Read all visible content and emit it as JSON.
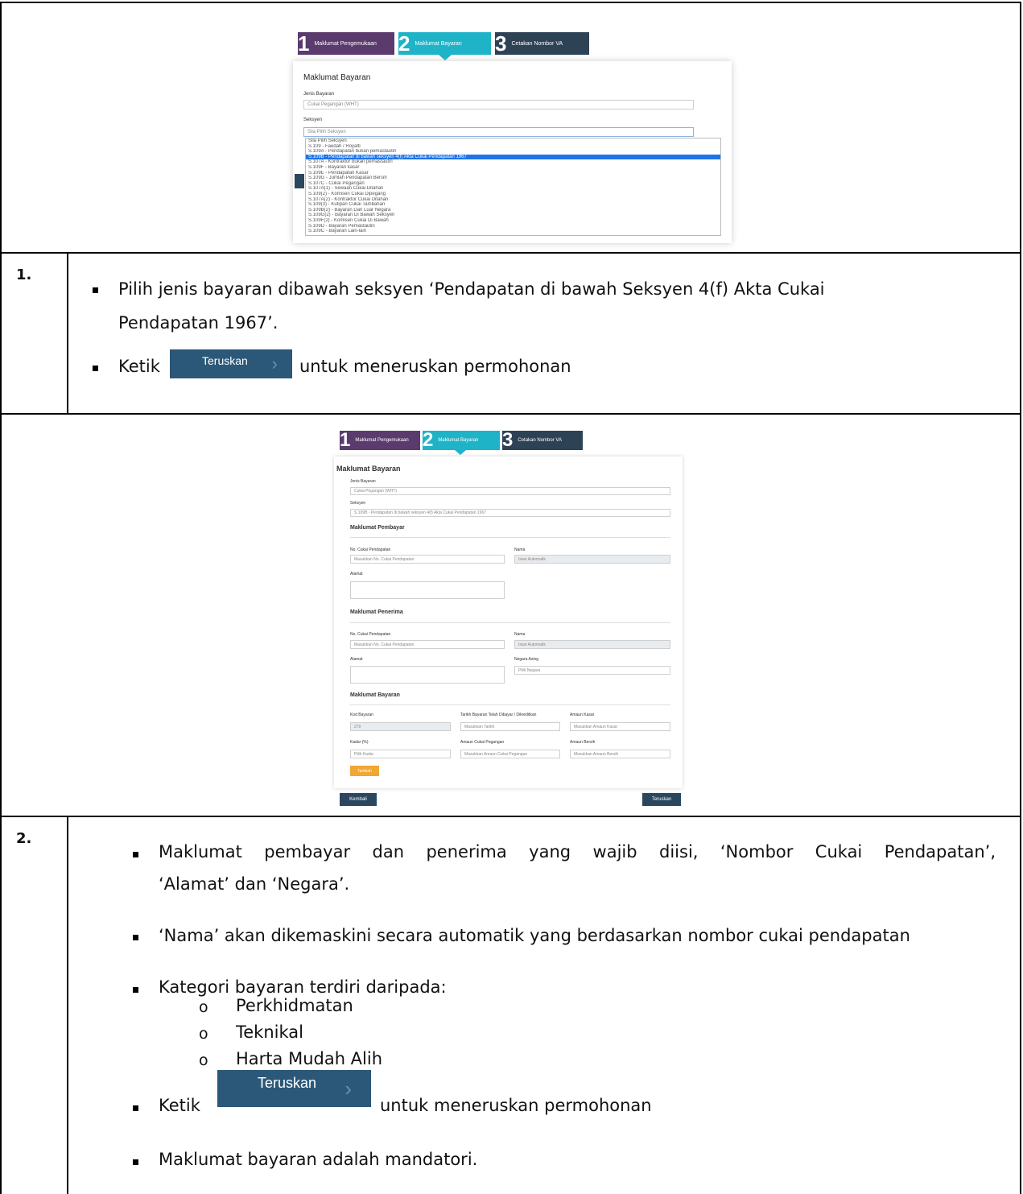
{
  "step_screenshot_1": {
    "steps": [
      {
        "num": "1",
        "label": "Maklumat Pengemukaan"
      },
      {
        "num": "2",
        "label": "Maklumat Bayaran"
      },
      {
        "num": "3",
        "label": "Cetakan Nombor VA"
      }
    ],
    "form_title": "Maklumat Bayaran",
    "jenis_label": "Jenis Bayaran",
    "jenis_value": "Cukai Pegangan (WHT)",
    "seksyen_label": "Seksyen",
    "seksyen_value": "Sila Pilih Seksyen",
    "dropdown_options": [
      "Sila Pilih Seksyen",
      "S.109 - Faedah / Royalti",
      "S.109A - Pendapatan bukan pemastautin",
      "S.109B - Pendapatan di bawah seksyen 4(f) Akta Cukai Pendapatan 1967",
      "S.107A - Kontraktor bukan pemastautin",
      "S.109F - Bayaran kasar",
      "S.109E - Pendapatan Kasar",
      "S.109G - Jumlah Pendapatan Bersih",
      "S.107C - Cukai Pegangan",
      "S.107A(1) - Sewaan Cukai Ditahan",
      "S.109(2) - Komisen Cukai Dipegang",
      "S.107A(2) - Kontraktor Cukai Ditahan",
      "S.109(3) - Kutipan Cukai Tambahan",
      "S.109B(2) - Bayaran Dari Luar Negara",
      "S.109G(2) - Bayaran Di Bawah Seksyen",
      "S.109F(2) - Komisen Cukai Di Bawah",
      "S.109D - Bayaran Pemastautin",
      "S.109C - Bayaran Lain-lain"
    ],
    "selected_option_index": 3
  },
  "step_1": {
    "number": "1.",
    "bullet_1_line_1": "Pilih jenis bayaran dibawah seksyen ‘Pendapatan di bawah Seksyen 4(f) Akta Cukai",
    "bullet_1_line_2": "Pendapatan 1967’.",
    "bullet_2_prefix": "Ketik",
    "bullet_2_suffix": "untuk meneruskan permohonan",
    "button_label": "Teruskan",
    "button_chevron": "›"
  },
  "step_screenshot_2": {
    "steps": [
      {
        "num": "1",
        "label": "Maklumat Pengemukaan"
      },
      {
        "num": "2",
        "label": "Maklumat Bayaran"
      },
      {
        "num": "3",
        "label": "Cetakan Nombor VA"
      }
    ],
    "form_title": "Maklumat Bayaran",
    "jenis_label": "Jenis Bayaran",
    "jenis_value": "Cukai Pegangan (WHT)",
    "seksyen_label": "Seksyen",
    "seksyen_value": "S.109B - Pendapatan di bawah seksyen 4(f) Akta Cukai Pendapatan 1967",
    "pembayar_title": "Maklumat Pembayar",
    "penerima_title": "Maklumat Penerima",
    "bayaran_title": "Maklumat Bayaran",
    "no_cukai_label": "No. Cukai Pendapatan",
    "no_cukai_placeholder": "Masukkan No. Cukai Pendapatan",
    "nama_label": "Nama",
    "nama_placeholder": "Isian Automatik",
    "alamat_label": "Alamat",
    "negara_label": "Negara Asing",
    "negara_value": "Pilih Negara",
    "kod_label": "Kod Bayaran",
    "kod_value": "279",
    "tarikh_label": "Tarikh Bayaran Telah Dibayar / Dikreditkan",
    "tarikh_placeholder": "Masukkan Tarikh",
    "amaun_kasar_label": "Amaun Kasar",
    "amaun_kasar_placeholder": "Masukkan Amaun Kasar",
    "kadar_label": "Kadar (%)",
    "kadar_value": "Pilih Kadar",
    "amaun_cukai_label": "Amaun Cukai Pegangan",
    "amaun_cukai_placeholder": "Masukkan Amaun Cukai Pegangan",
    "amaun_bersih_label": "Amaun Bersih",
    "amaun_bersih_placeholder": "Masukkan Amaun Bersih",
    "add_button": "Tambah",
    "back_button": "Kembali",
    "next_button": "Teruskan"
  },
  "step_2": {
    "number": "2.",
    "bullet_1_line_1": "Maklumat pembayar dan penerima yang wajib diisi, ‘Nombor Cukai Pendapatan’,",
    "bullet_1_line_2": "‘Alamat’ dan ‘Negara’.",
    "bullet_2": "‘Nama’ akan dikemaskini secara automatik yang berdasarkan nombor cukai pendapatan",
    "bullet_3": "Kategori bayaran terdiri daripada:",
    "categories": [
      "Perkhidmatan",
      "Teknikal",
      "Harta Mudah Alih"
    ],
    "sub_marker": "o",
    "bullet_4_prefix": "Ketik",
    "bullet_4_suffix": "untuk meneruskan permohonan",
    "button_label": "Teruskan",
    "button_chevron": "›",
    "bullet_5": "Maklumat bayaran adalah mandatori."
  },
  "colors": {
    "step1": "#5b3a6e",
    "step2": "#1fb3c8",
    "step3": "#2e4256",
    "button": "#2b5878",
    "add_button": "#f0a733"
  }
}
